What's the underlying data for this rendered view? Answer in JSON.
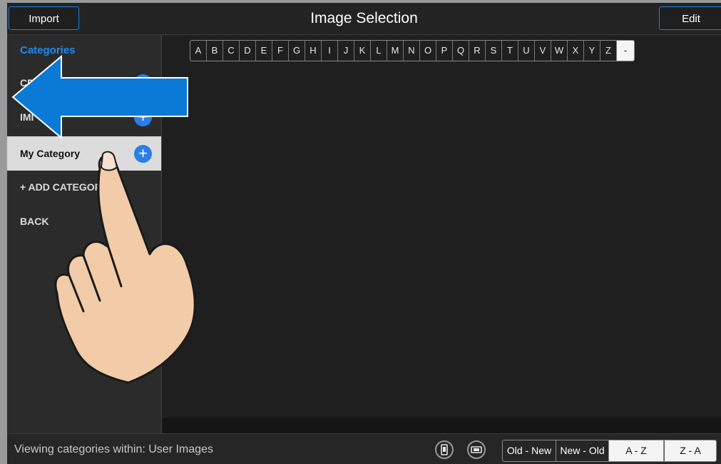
{
  "header": {
    "import_label": "Import",
    "title": "Image Selection",
    "edit_label": "Edit"
  },
  "sidebar": {
    "heading": "Categories",
    "items": [
      {
        "label": "CR"
      },
      {
        "label": "IMI"
      },
      {
        "label": "My Category"
      },
      {
        "label": "+ ADD CATEGOR"
      },
      {
        "label": "BACK"
      }
    ]
  },
  "alphabet": [
    "A",
    "B",
    "C",
    "D",
    "E",
    "F",
    "G",
    "H",
    "I",
    "J",
    "K",
    "L",
    "M",
    "N",
    "O",
    "P",
    "Q",
    "R",
    "S",
    "T",
    "U",
    "V",
    "W",
    "X",
    "Y",
    "Z",
    "-"
  ],
  "footer": {
    "status": "Viewing categories within: User Images",
    "sort_options": [
      "Old - New",
      "New - Old",
      "A - Z",
      "Z - A"
    ]
  },
  "colors": {
    "accent": "#2a7ee6",
    "selected_bg": "#dcdcdc",
    "arrow": "#0a7ad6",
    "hand": "#f2cba8"
  },
  "icons": {
    "portrait": "portrait-orientation-icon",
    "landscape": "landscape-orientation-icon",
    "plus": "plus-circle-icon",
    "arrow": "left-arrow-overlay",
    "hand": "pointing-hand-overlay"
  }
}
